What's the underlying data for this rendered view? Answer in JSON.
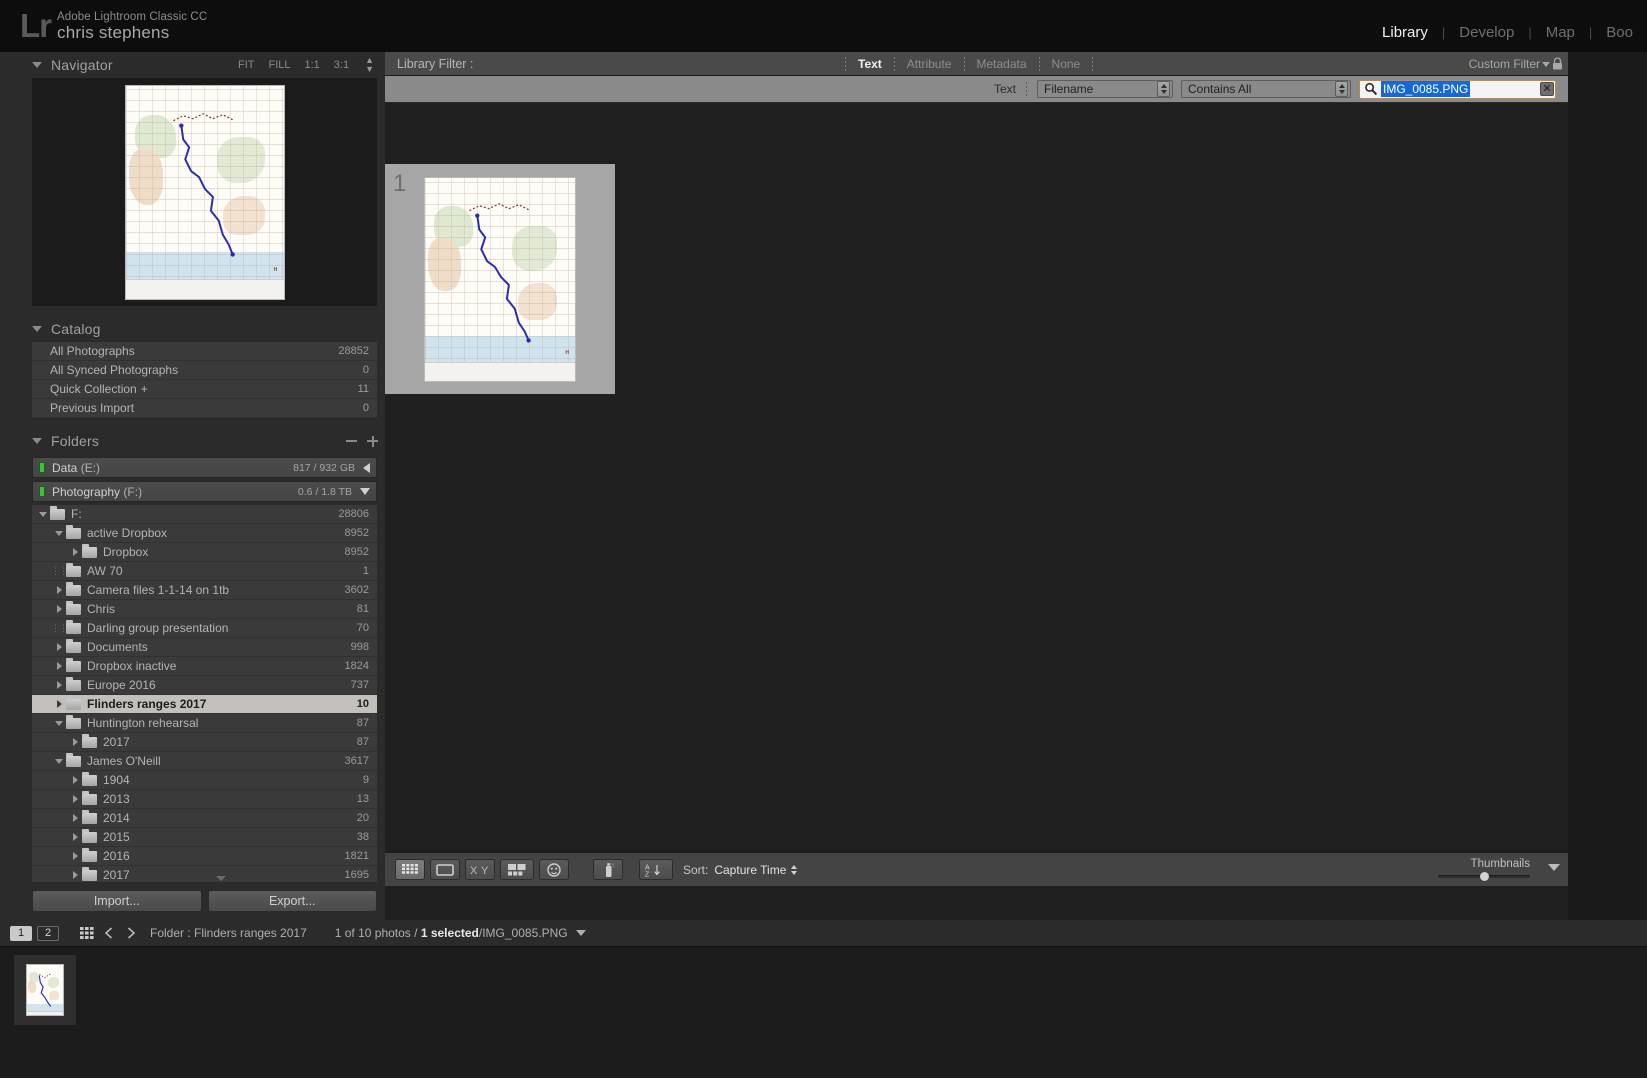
{
  "identity": {
    "logo": "Lr",
    "product": "Adobe Lightroom Classic CC",
    "user": "chris stephens"
  },
  "modules": [
    {
      "label": "Library",
      "active": true
    },
    {
      "label": "Develop",
      "active": false
    },
    {
      "label": "Map",
      "active": false
    },
    {
      "label": "Boo",
      "active": false
    }
  ],
  "navigator": {
    "title": "Navigator",
    "zoom_levels": [
      "FIT",
      "FILL",
      "1:1",
      "3:1"
    ]
  },
  "catalog": {
    "title": "Catalog",
    "items": [
      {
        "label": "All Photographs",
        "count": "28852"
      },
      {
        "label": "All Synced Photographs",
        "count": "0"
      },
      {
        "label": "Quick Collection",
        "plus": "+",
        "count": "11"
      },
      {
        "label": "Previous Import",
        "count": "0"
      }
    ]
  },
  "folders": {
    "title": "Folders",
    "volumes": [
      {
        "name": "Data",
        "drive": "(E:)",
        "space": "817 / 932 GB",
        "collapsed": true
      },
      {
        "name": "Photography",
        "drive": "(F:)",
        "space": "0.6 / 1.8 TB",
        "collapsed": false
      }
    ],
    "tree": [
      {
        "label": "F:",
        "count": "28806",
        "indent": 0,
        "disc": "down",
        "selected": false
      },
      {
        "label": "active Dropbox",
        "count": "8952",
        "indent": 1,
        "disc": "down",
        "selected": false
      },
      {
        "label": "Dropbox",
        "count": "8952",
        "indent": 2,
        "disc": "right",
        "selected": false
      },
      {
        "label": "AW 70",
        "count": "1",
        "indent": 1,
        "disc": "dots",
        "selected": false
      },
      {
        "label": "Camera files 1-1-14 on 1tb",
        "count": "3602",
        "indent": 1,
        "disc": "right",
        "selected": false
      },
      {
        "label": "Chris",
        "count": "81",
        "indent": 1,
        "disc": "right",
        "selected": false
      },
      {
        "label": "Darling group presentation",
        "count": "70",
        "indent": 1,
        "disc": "dots",
        "selected": false
      },
      {
        "label": "Documents",
        "count": "998",
        "indent": 1,
        "disc": "right",
        "selected": false
      },
      {
        "label": "Dropbox inactive",
        "count": "1824",
        "indent": 1,
        "disc": "right",
        "selected": false
      },
      {
        "label": "Europe 2016",
        "count": "737",
        "indent": 1,
        "disc": "right",
        "selected": false
      },
      {
        "label": "Flinders ranges 2017",
        "count": "10",
        "indent": 1,
        "disc": "right",
        "selected": true
      },
      {
        "label": "Huntington rehearsal",
        "count": "87",
        "indent": 1,
        "disc": "down",
        "selected": false
      },
      {
        "label": "2017",
        "count": "87",
        "indent": 2,
        "disc": "right",
        "selected": false
      },
      {
        "label": "James O'Neill",
        "count": "3617",
        "indent": 1,
        "disc": "down",
        "selected": false
      },
      {
        "label": "1904",
        "count": "9",
        "indent": 2,
        "disc": "right",
        "selected": false
      },
      {
        "label": "2013",
        "count": "13",
        "indent": 2,
        "disc": "right",
        "selected": false
      },
      {
        "label": "2014",
        "count": "20",
        "indent": 2,
        "disc": "right",
        "selected": false
      },
      {
        "label": "2015",
        "count": "38",
        "indent": 2,
        "disc": "right",
        "selected": false
      },
      {
        "label": "2016",
        "count": "1821",
        "indent": 2,
        "disc": "right",
        "selected": false
      },
      {
        "label": "2017",
        "count": "1695",
        "indent": 2,
        "disc": "right",
        "selected": false
      }
    ]
  },
  "panel_buttons": {
    "import": "Import...",
    "export": "Export..."
  },
  "library_filter": {
    "title": "Library Filter :",
    "tabs": [
      {
        "label": "Text",
        "active": true
      },
      {
        "label": "Attribute",
        "active": false
      },
      {
        "label": "Metadata",
        "active": false
      },
      {
        "label": "None",
        "active": false
      }
    ],
    "custom_filter": "Custom Filter",
    "text_row": {
      "label": "Text",
      "field_select": "Filename",
      "rule_select": "Contains All",
      "search_value": "IMG_0085.PNG",
      "search_placeholder": ""
    }
  },
  "grid": {
    "cell_index": "1"
  },
  "toolbar": {
    "view_modes": [
      "grid-view",
      "loupe-view",
      "compare-view",
      "survey-view",
      "people-view"
    ],
    "painter": "spray-can",
    "sort_label": "Sort:",
    "sort_value": "Capture Time",
    "thumbnails_label": "Thumbnails"
  },
  "filmstrip": {
    "page_tabs": [
      "1",
      "2"
    ],
    "source_label": "Folder : Flinders ranges 2017",
    "status_count": "1 of 10 photos /",
    "status_selected": "1 selected",
    "status_file": "/IMG_0085.PNG"
  },
  "colors": {
    "accent_selection": "#1569d6",
    "search_border": "#c08a3e",
    "panel_bg": "#2b2b2b",
    "row_bg": "#3a3a3a",
    "selected_row": "#c3c0bb",
    "drive_led": "#3ec23e"
  }
}
